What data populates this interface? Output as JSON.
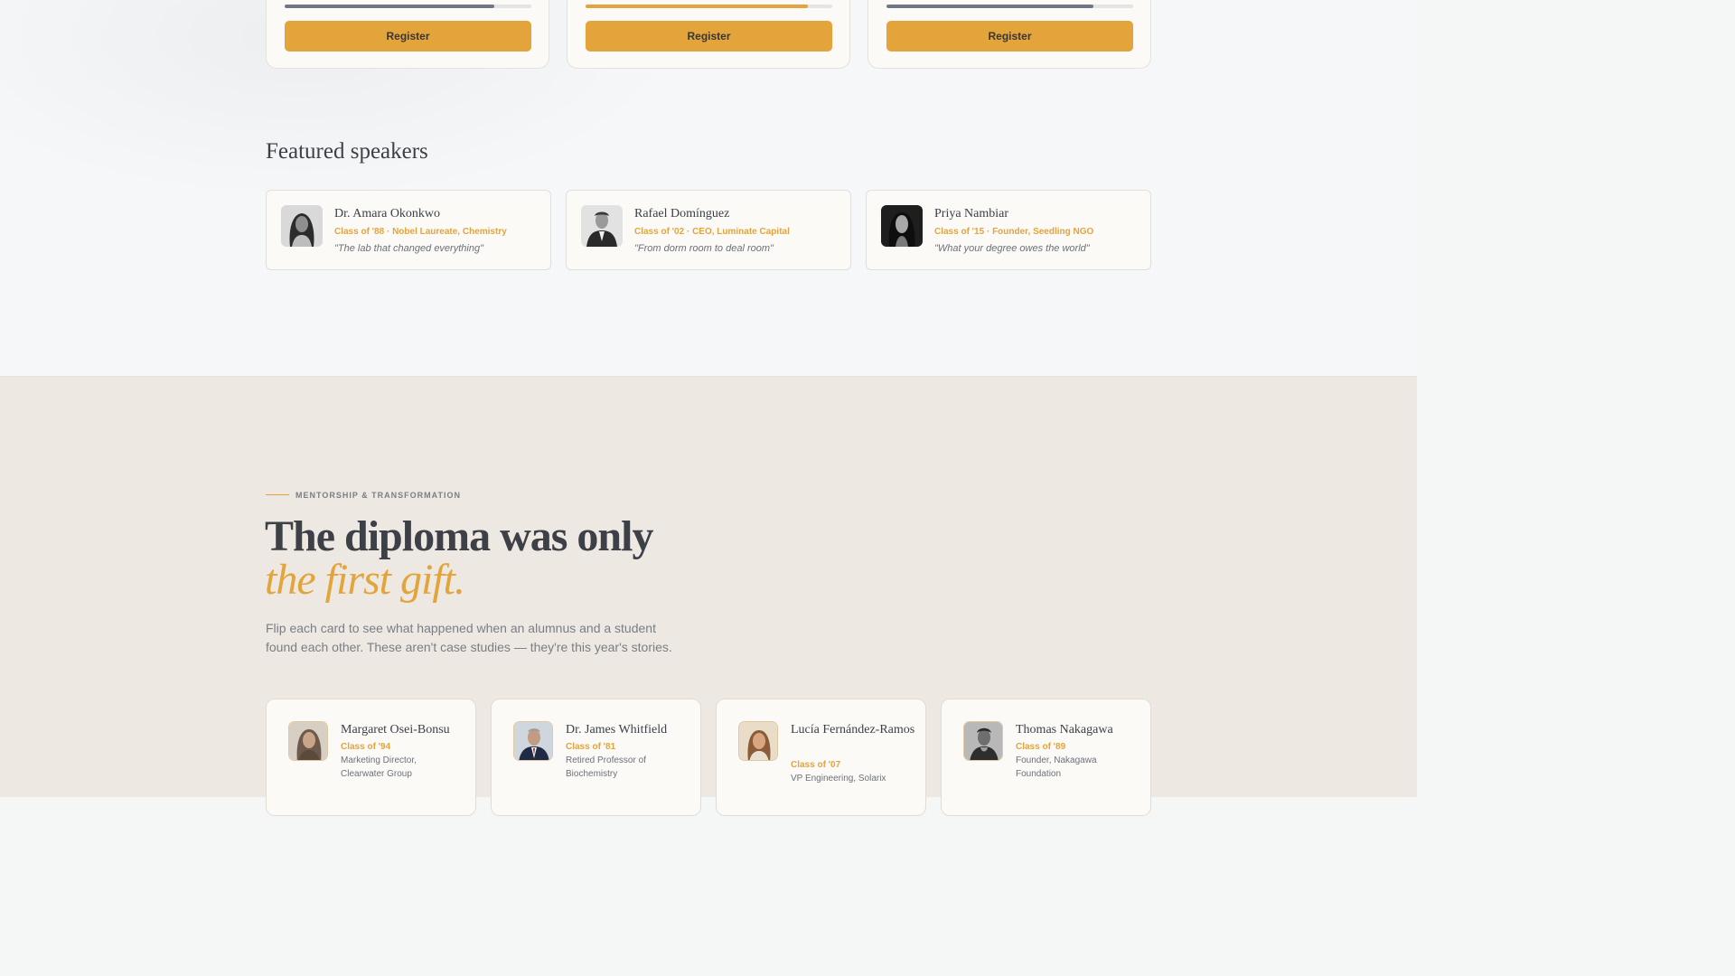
{
  "events": [
    {
      "register_label": "Register",
      "progress": 0.85,
      "bar_color": "#6f7786"
    },
    {
      "register_label": "Register",
      "progress": 0.9,
      "bar_color": "#e3a43b"
    },
    {
      "register_label": "Register",
      "progress": 0.84,
      "bar_color": "#6f7786"
    }
  ],
  "speakers_section": {
    "title": "Featured speakers",
    "speakers": [
      {
        "name": "Dr. Amara Okonkwo",
        "meta": "Class of '88 · Nobel Laureate, Chemistry",
        "quote": "\"The lab that changed everything\""
      },
      {
        "name": "Rafael Domínguez",
        "meta": "Class of '02 · CEO, Luminate Capital",
        "quote": "\"From dorm room to deal room\""
      },
      {
        "name": "Priya Nambiar",
        "meta": "Class of '15 · Founder, Seedling NGO",
        "quote": "\"What your degree owes the world\""
      }
    ]
  },
  "mentorship": {
    "eyebrow": "MENTORSHIP & TRANSFORMATION",
    "headline_line1": "The diploma was only",
    "headline_line2": "the first gift.",
    "subtext": "Flip each card to see what happened when an alumnus and a student found each other. These aren't case studies — they're this year's stories.",
    "mentors": [
      {
        "name": "Margaret Osei-Bonsu",
        "class": "Class of '94",
        "role": "Marketing Director, Clearwater Group"
      },
      {
        "name": "Dr. James Whitfield",
        "class": "Class of '81",
        "role": "Retired Professor of Biochemistry"
      },
      {
        "name": "Lucía Fernández-Ramos",
        "class": "Class of '07",
        "role": "VP Engineering, Solarix"
      },
      {
        "name": "Thomas Nakagawa",
        "class": "Class of '89",
        "role": "Founder, Nakagawa Foundation"
      }
    ]
  },
  "colors": {
    "accent": "#e3a43b",
    "text": "#3d4047",
    "muted": "#7a7d84"
  }
}
